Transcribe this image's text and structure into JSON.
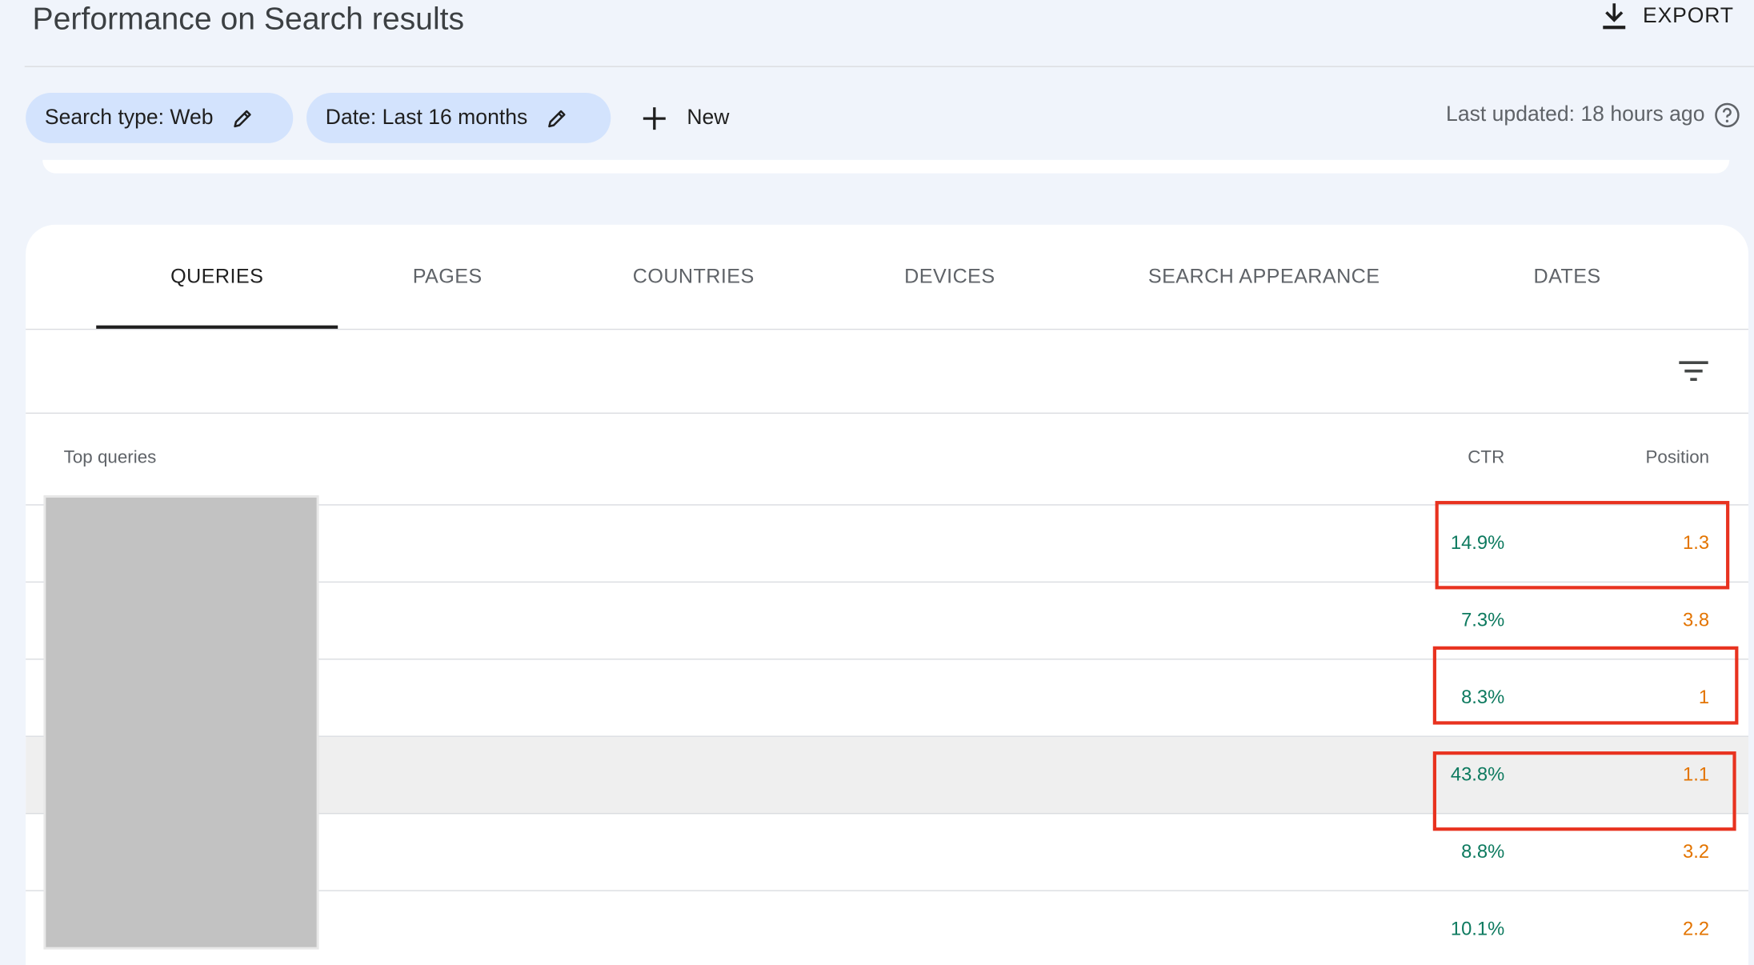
{
  "header": {
    "title": "Performance on Search results",
    "export_label": "EXPORT"
  },
  "filters": {
    "search_type_label": "Search type: Web",
    "date_label": "Date: Last 16 months",
    "new_label": "New",
    "last_updated": "Last updated: 18 hours ago"
  },
  "tabs": [
    {
      "label": "QUERIES",
      "active": true
    },
    {
      "label": "PAGES",
      "active": false
    },
    {
      "label": "COUNTRIES",
      "active": false
    },
    {
      "label": "DEVICES",
      "active": false
    },
    {
      "label": "SEARCH APPEARANCE",
      "active": false
    },
    {
      "label": "DATES",
      "active": false
    }
  ],
  "table": {
    "columns": {
      "query": "Top queries",
      "ctr": "CTR",
      "position": "Position"
    },
    "rows": [
      {
        "ctr": "14.9%",
        "position": "1.3"
      },
      {
        "ctr": "7.3%",
        "position": "3.8"
      },
      {
        "ctr": "8.3%",
        "position": "1"
      },
      {
        "ctr": "43.8%",
        "position": "1.1"
      },
      {
        "ctr": "8.8%",
        "position": "3.2"
      },
      {
        "ctr": "10.1%",
        "position": "2.2"
      }
    ]
  },
  "icons": {
    "export": "download-icon",
    "edit": "pencil-icon",
    "add": "plus-icon",
    "help": "help-circle-icon",
    "filter": "filter-list-icon"
  },
  "colors": {
    "background": "#f0f4fb",
    "chip": "#d3e3fd",
    "ctr_text": "#0d7a5f",
    "position_text": "#e37400",
    "annotation": "#e8321f"
  }
}
